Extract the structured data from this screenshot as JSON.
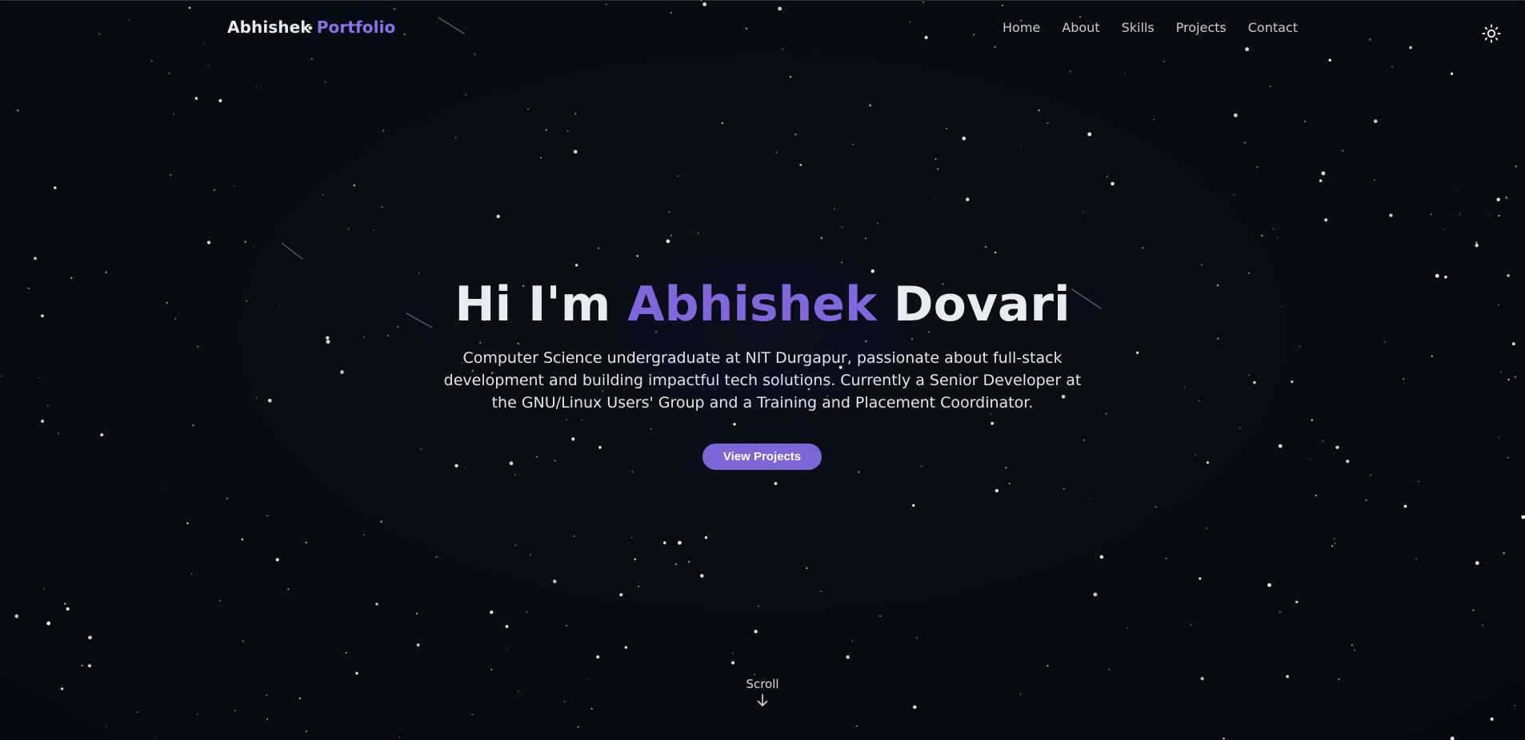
{
  "navbar": {
    "brand_first": "Abhishek",
    "brand_second": "Portfolio",
    "links": [
      "Home",
      "About",
      "Skills",
      "Projects",
      "Contact"
    ],
    "theme_toggle_icon": "sun-icon"
  },
  "hero": {
    "greeting": "Hi I'm",
    "name_first": "Abhishek",
    "name_last": "Dovari",
    "description": "Computer Science undergraduate at NIT Durgapur, passionate about full-stack development and building impactful tech solutions. Currently a Senior Developer at the GNU/Linux Users' Group and a Training and Placement Coordinator.",
    "cta_label": "View Projects"
  },
  "scroll": {
    "label": "Scroll",
    "icon": "arrow-down-icon"
  },
  "colors": {
    "background": "#080b14",
    "accent": "#8266dc",
    "button": "#7e66d9",
    "text": "#e8ebf6"
  }
}
